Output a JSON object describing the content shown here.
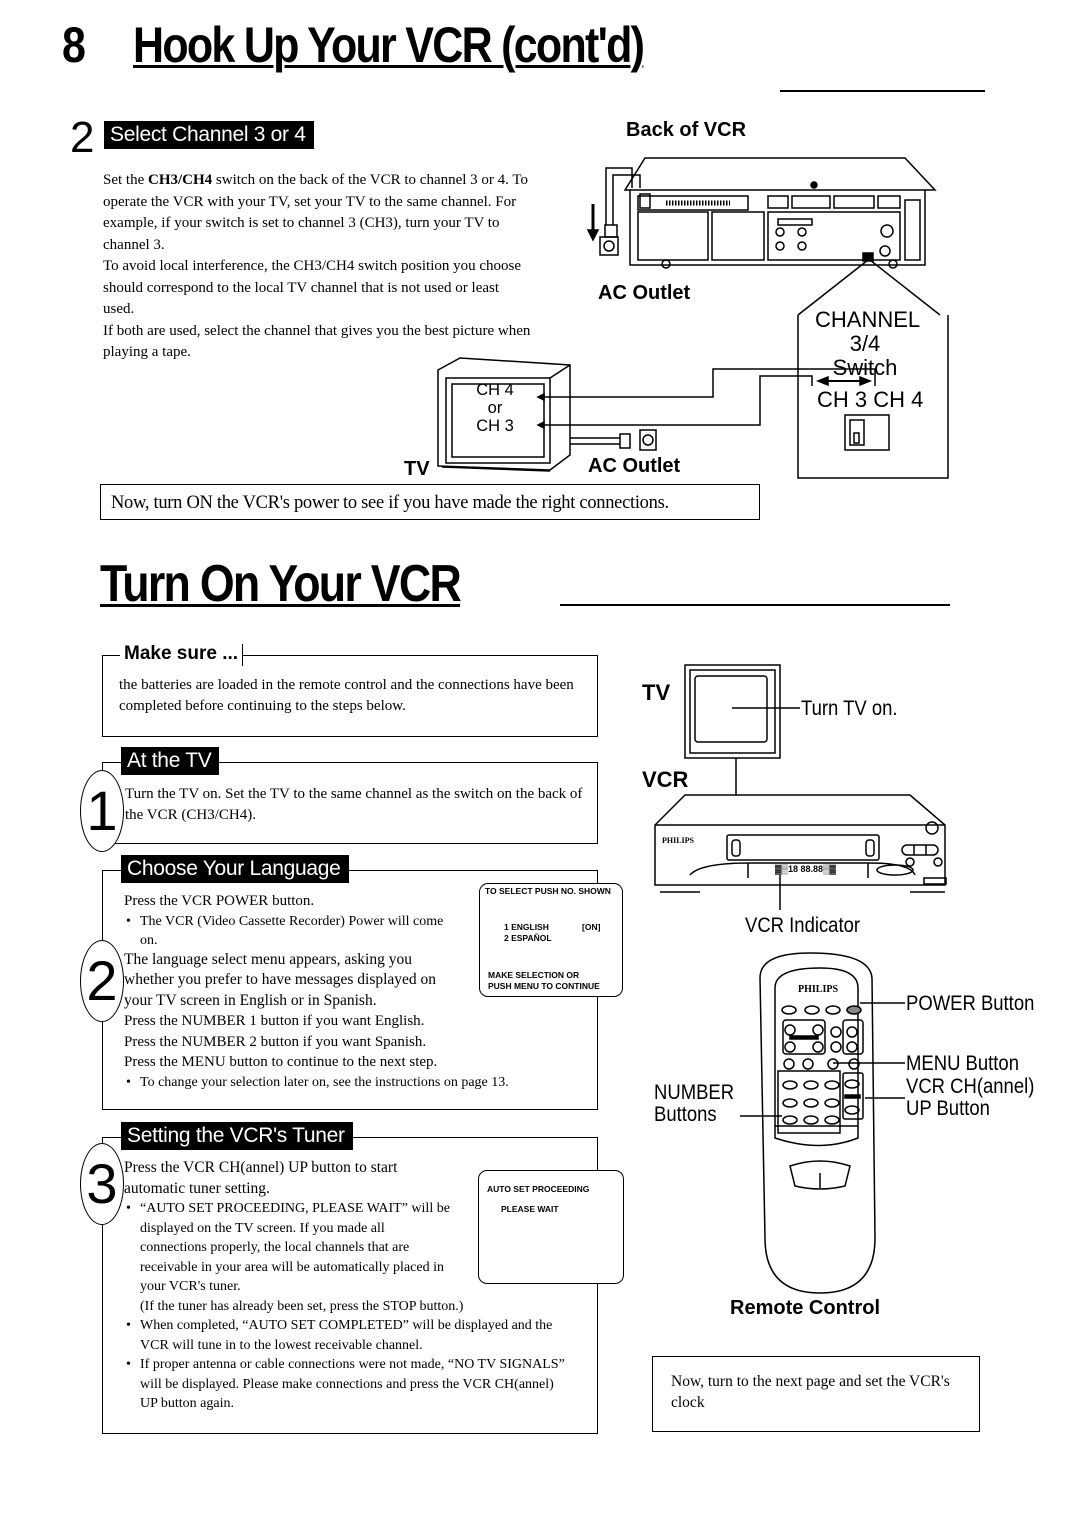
{
  "page_header": {
    "page_number": "8",
    "title": "Hook Up Your VCR (cont'd)"
  },
  "select_channel": {
    "step_number": "2",
    "tag": "Select Channel 3 or 4",
    "paragraphs": [
      "Set the CH3/CH4 switch on the back of the VCR to channel 3 or 4. To operate the VCR with your TV, set your TV to the same channel. For example, if your switch is set to channel 3 (CH3), turn your TV to channel 3.",
      "To avoid local interference, the CH3/CH4 switch position you choose should correspond to the local TV channel that is not used or least used.",
      "If both are used, select the channel that gives you the best picture when playing a tape."
    ],
    "bold_term": "CH3/CH4",
    "diagram": {
      "back_of_vcr_label": "Back of VCR",
      "ac_outlet_label_top": "AC Outlet",
      "ac_outlet_label_bottom": "AC Outlet",
      "tv_label": "TV",
      "tv_screen_lines": [
        "CH 4",
        "or",
        "CH 3"
      ],
      "callout_title_line1": "CHANNEL",
      "callout_title_line2": "3/4 Switch",
      "callout_positions": "CH 3 CH 4"
    },
    "note": "Now, turn ON the VCR's power to see if you have made the right connections."
  },
  "turn_on": {
    "title": "Turn On Your VCR",
    "make_sure": {
      "label": "Make sure ...",
      "text": "the batteries are loaded in the remote control and the connections have been completed before continuing to the steps below."
    },
    "steps": [
      {
        "number": "1",
        "tag": "At the TV",
        "lines": [
          "Turn the TV on. Set the TV to the same channel as the switch on the back of the VCR (CH3/CH4)."
        ]
      },
      {
        "number": "2",
        "tag": "Choose Your Language",
        "line1": "Press the VCR POWER button.",
        "bullet1": "The VCR (Video Cassette Recorder) Power will come on.",
        "line2": "The language select menu appears, asking you whether you prefer to have messages displayed on your TV screen in English or in Spanish.",
        "line3": "Press the NUMBER 1 button if you want English.",
        "line4": "Press the NUMBER 2 button if you want Spanish.",
        "line5": "Press the MENU button to continue to the next step.",
        "bullet2": "To change your selection later on, see the instructions on page 13.",
        "screen": {
          "header": "TO SELECT PUSH NO. SHOWN",
          "option1": "1  ENGLISH",
          "option1_state": "[ON]",
          "option2": "2  ESPAÑOL",
          "footer1": "MAKE SELECTION OR",
          "footer2": "PUSH MENU TO CONTINUE"
        }
      },
      {
        "number": "3",
        "tag": "Setting the VCR's Tuner",
        "line1": "Press the VCR CH(annel) UP button to start automatic tuner setting.",
        "bullet1": "“AUTO SET PROCEEDING, PLEASE WAIT” will be displayed on the TV screen. If you made all connections properly, the local channels that are receivable in your area will be automatically placed in your VCR's tuner.",
        "paren": "(If the tuner has already been set, press the STOP button.)",
        "bullet2": "When completed, “AUTO SET COMPLETED” will be displayed and the VCR will tune in to the lowest receivable channel.",
        "bullet3": "If proper antenna or cable connections were not made, “NO TV SIGNALS” will be displayed. Please make connections and press the VCR CH(annel) UP button again.",
        "screen": {
          "line1": "AUTO SET PROCEEDING",
          "line2": "PLEASE WAIT"
        }
      }
    ],
    "diagram": {
      "tv_label": "TV",
      "turn_tv_on": "Turn TV on.",
      "vcr_label": "VCR",
      "vcr_brand": "PHILIPS",
      "vcr_indicator": "VCR Indicator",
      "remote_brand": "PHILIPS",
      "power_button": "POWER Button",
      "menu_button": "MENU Button",
      "ch_up_line1": "VCR CH(annel)",
      "ch_up_line2": "UP Button",
      "number_line1": "NUMBER",
      "number_line2": "Buttons",
      "remote_caption": "Remote Control"
    },
    "next_page_note": "Now, turn to the next page and set the VCR's clock"
  }
}
